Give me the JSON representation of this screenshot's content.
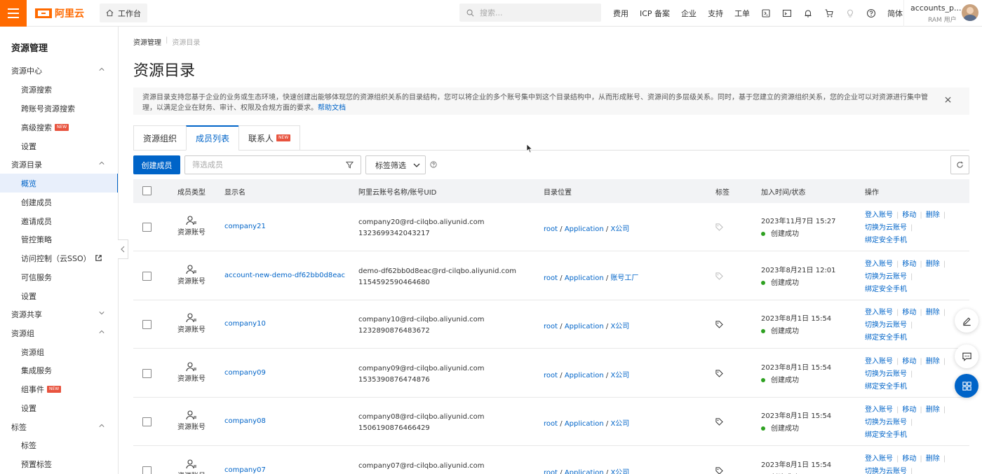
{
  "topbar": {
    "logo_text": "阿里云",
    "workbench": "工作台",
    "search_placeholder": "搜索...",
    "nav": [
      "费用",
      "ICP 备案",
      "企业",
      "支持",
      "工单"
    ],
    "lang": "简体",
    "account_name": "accounts_p...",
    "account_role": "RAM 用户"
  },
  "sidebar": {
    "title": "资源管理",
    "groups": [
      {
        "label": "资源中心",
        "expanded": true,
        "items": [
          {
            "label": "资源搜索"
          },
          {
            "label": "跨账号资源搜索"
          },
          {
            "label": "高级搜索",
            "badge": "NEW"
          },
          {
            "label": "设置"
          }
        ]
      },
      {
        "label": "资源目录",
        "expanded": true,
        "items": [
          {
            "label": "概览",
            "active": true
          },
          {
            "label": "创建成员"
          },
          {
            "label": "邀请成员"
          },
          {
            "label": "管控策略"
          },
          {
            "label": "访问控制（云SSO）"
          },
          {
            "label": "可信服务"
          },
          {
            "label": "设置"
          }
        ]
      },
      {
        "label": "资源共享",
        "expanded": false,
        "items": []
      },
      {
        "label": "资源组",
        "expanded": true,
        "items": [
          {
            "label": "资源组"
          },
          {
            "label": "集成服务"
          },
          {
            "label": "组事件",
            "badge": "NEW"
          },
          {
            "label": "设置"
          }
        ]
      },
      {
        "label": "标签",
        "expanded": true,
        "items": [
          {
            "label": "标签"
          },
          {
            "label": "预置标签"
          }
        ]
      }
    ]
  },
  "main": {
    "breadcrumb": [
      "资源管理",
      "资源目录"
    ],
    "title": "资源目录",
    "notice": "资源目录支持您基于企业的业务或生态环境，快速创建出能够体现您的资源组织关系的目录结构，您可以将企业的多个账号集中到这个目录结构中，从而形成账号、资源间的多层级关系。同时，基于您建立的资源组织关系，您的企业可以对资源进行集中管理，以满足企业在财务、审计、权限及合规方面的要求。",
    "notice_link": "帮助文档",
    "tabs": [
      {
        "label": "资源组织"
      },
      {
        "label": "成员列表",
        "active": true
      },
      {
        "label": "联系人",
        "badge": "NEW"
      }
    ],
    "create_button": "创建成员",
    "filter_placeholder": "筛选成员",
    "tag_filter": "标签筛选",
    "columns": [
      "成员类型",
      "显示名",
      "阿里云账号名称/账号UID",
      "目录位置",
      "标签",
      "加入时间/状态",
      "操作"
    ],
    "rows": [
      {
        "type": "资源账号",
        "name": "company21",
        "account": "company20@rd-cilqbo.aliyunid.com",
        "uid": "1323699342043217",
        "path": [
          "root",
          "Application",
          "X公司"
        ],
        "time": "2023年11月7日 15:27",
        "status": "创建成功",
        "tag_muted": true
      },
      {
        "type": "资源账号",
        "name": "account-new-demo-df62bb0d8eac",
        "account": "demo-df62bb0d8eac@rd-cilqbo.aliyunid.com",
        "uid": "1154592590464680",
        "path": [
          "root",
          "Application",
          "账号工厂"
        ],
        "time": "2023年8月21日 12:01",
        "status": "创建成功",
        "tag_muted": true
      },
      {
        "type": "资源账号",
        "name": "company10",
        "account": "company10@rd-cilqbo.aliyunid.com",
        "uid": "1232890876483672",
        "path": [
          "root",
          "Application",
          "X公司"
        ],
        "time": "2023年8月1日 15:54",
        "status": "创建成功",
        "tag_muted": false
      },
      {
        "type": "资源账号",
        "name": "company09",
        "account": "company09@rd-cilqbo.aliyunid.com",
        "uid": "1535390876474876",
        "path": [
          "root",
          "Application",
          "X公司"
        ],
        "time": "2023年8月1日 15:54",
        "status": "创建成功",
        "tag_muted": false
      },
      {
        "type": "资源账号",
        "name": "company08",
        "account": "company08@rd-cilqbo.aliyunid.com",
        "uid": "1506190876466429",
        "path": [
          "root",
          "Application",
          "X公司"
        ],
        "time": "2023年8月1日 15:54",
        "status": "创建成功",
        "tag_muted": false
      },
      {
        "type": "资源账号",
        "name": "company07",
        "account": "company07@rd-cilqbo.aliyunid.com",
        "uid": "",
        "path": [
          "root",
          "Application",
          "X公司"
        ],
        "time": "2023年8月1日 15:54",
        "status": "创建成功",
        "tag_muted": false
      }
    ],
    "ops": {
      "login": "登入账号",
      "move": "移动",
      "delete": "删除",
      "switch": "切换为云账号",
      "bind": "绑定安全手机"
    },
    "path_sep": "/"
  }
}
